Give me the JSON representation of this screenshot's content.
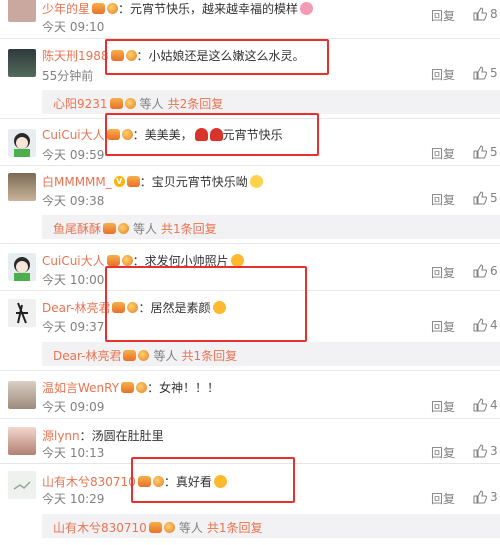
{
  "comments": [
    {
      "user": "少年的星",
      "text": "：元宵节快乐，越来越幸福的模样",
      "time": "今天 09:10",
      "likes": "8"
    },
    {
      "user": "陈天刑1988",
      "text": "：小姑娘还是这么嫩这么水灵。",
      "time": "55分钟前",
      "likes": "5"
    },
    {
      "user": "CuiCui大人",
      "text": "：美美美，",
      "text2": "元宵节快乐",
      "time": "今天 09:59",
      "likes": "5"
    },
    {
      "user": "白MMMMM_",
      "text": "：宝贝元宵节快乐呦",
      "time": "今天 09:38",
      "likes": "5"
    },
    {
      "user": "CuiCui大人",
      "text": "：求发何小帅照片",
      "time": "今天 10:00",
      "likes": "6"
    },
    {
      "user": "Dear-林亮君",
      "text": "：居然是素颜",
      "time": "今天 09:37",
      "likes": "4"
    },
    {
      "user": "温如言WenRY",
      "text": "：女神！！！",
      "time": "今天 09:09",
      "likes": "4"
    },
    {
      "user": "源lynn",
      "text": "：汤圆在肚肚里",
      "time": "今天 10:13",
      "likes": "3"
    },
    {
      "user": "山有木兮830710",
      "text": "：真好看",
      "time": "今天 10:29",
      "likes": "3"
    }
  ],
  "reply_bars": [
    {
      "user": "心阳9231",
      "etc": "等人",
      "count": "共2条回复"
    },
    {
      "user": "鱼尾酥酥",
      "etc": "等人",
      "count": "共1条回复"
    },
    {
      "user": "Dear-林亮君",
      "etc": "等人",
      "count": "共1条回复"
    },
    {
      "user": "山有木兮830710",
      "etc": "等人",
      "count": "共1条回复"
    }
  ],
  "actions": {
    "reply": "回复"
  },
  "colors": {
    "username": "#eb7350",
    "highlight_box": "#e8312e",
    "bar_bg": "#f2f2f5",
    "meta": "#808080"
  }
}
